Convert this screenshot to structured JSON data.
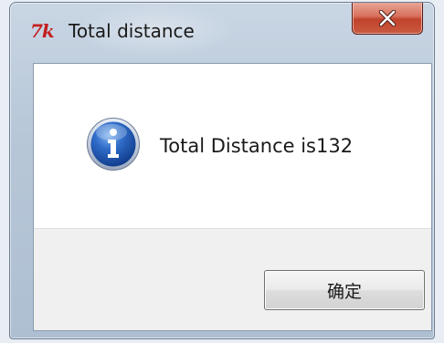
{
  "window": {
    "title": "Total distance",
    "app_icon_glyph": "7k",
    "close_glyph": "x",
    "close_icon": "close-icon",
    "info_icon": "information-icon"
  },
  "message": {
    "text": "Total Distance is132"
  },
  "buttons": {
    "ok_label": "确定"
  },
  "colors": {
    "close_button": "#c1432b",
    "info_icon_blue": "#1f4fa8",
    "app_icon_red": "#c41f1f"
  }
}
